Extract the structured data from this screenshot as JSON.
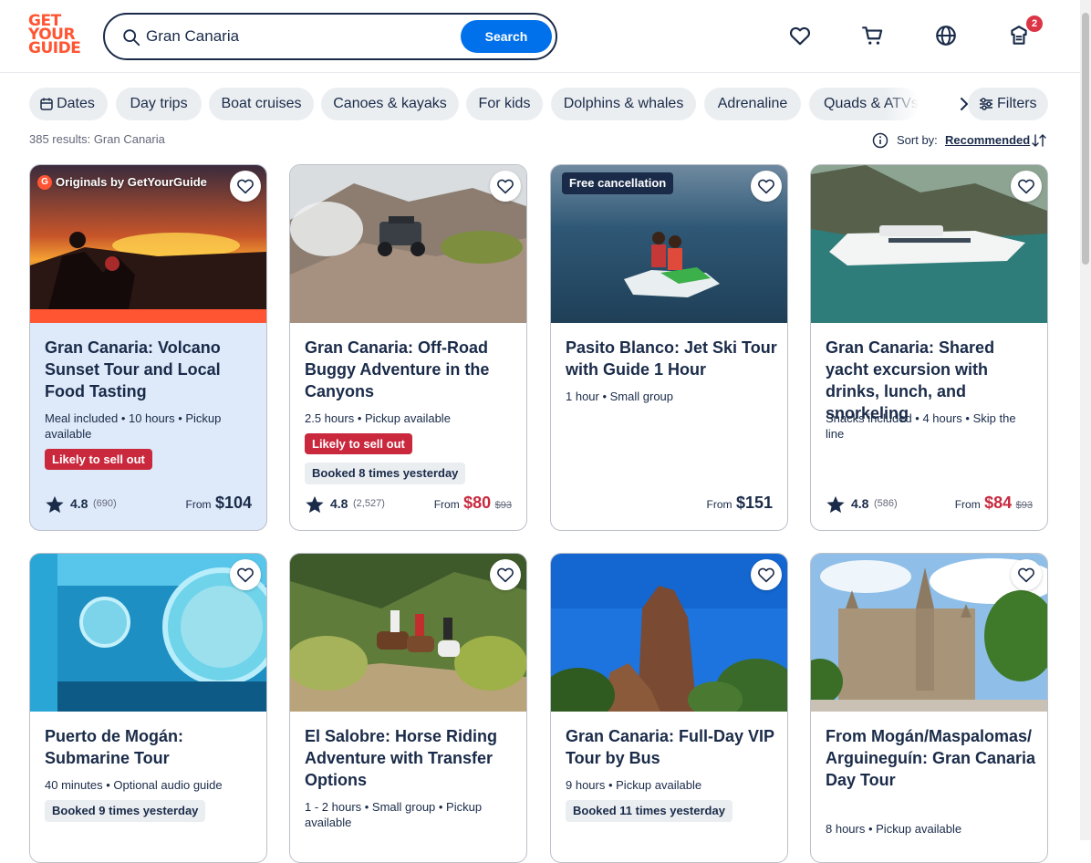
{
  "header": {
    "logo_lines": [
      "GET",
      "YOUR",
      "GUIDE"
    ],
    "search_value": "Gran Canaria",
    "search_button": "Search",
    "cart_badge": "2"
  },
  "chips": [
    "Dates",
    "Day trips",
    "Boat cruises",
    "Canoes & kayaks",
    "For kids",
    "Dolphins & whales",
    "Adrenaline",
    "Quads & ATVs"
  ],
  "filters_label": "Filters",
  "results_text": "385 results: Gran Canaria",
  "sort": {
    "label": "Sort by:",
    "value": "Recommended"
  },
  "cards": [
    {
      "badge": "Originals by GetYourGuide",
      "title": "Gran Canaria: Volcano Sunset Tour and Local Food Tasting",
      "meta": "Meal included • 10 hours • Pickup available",
      "pill_red": "Likely to sell out",
      "rating": "4.8",
      "reviews": "(690)",
      "from": "From",
      "price": "$104"
    },
    {
      "title": "Gran Canaria: Off-Road Buggy Adventure in the Canyons",
      "meta": "2.5 hours • Pickup available",
      "pill_red": "Likely to sell out",
      "pill_grey": "Booked 8 times yesterday",
      "rating": "4.8",
      "reviews": "(2,527)",
      "from": "From",
      "price": "$80",
      "old_price": "$93"
    },
    {
      "badge": "Free cancellation",
      "title": "Pasito Blanco: Jet Ski Tour with Guide 1 Hour",
      "meta": "1 hour • Small group",
      "from": "From",
      "price": "$151"
    },
    {
      "title": "Gran Canaria: Shared yacht excursion with drinks, lunch, and snorkeling",
      "meta": "Snacks included • 4 hours • Skip the line",
      "rating": "4.8",
      "reviews": "(586)",
      "from": "From",
      "price": "$84",
      "old_price": "$93"
    },
    {
      "title": "Puerto de Mogán: Submarine Tour",
      "meta": "40 minutes • Optional audio guide",
      "pill_grey": "Booked 9 times yesterday"
    },
    {
      "title": "El Salobre: Horse Riding Adventure with Transfer Options",
      "meta": "1 - 2 hours • Small group • Pickup available"
    },
    {
      "title": "Gran Canaria: Full-Day VIP Tour by Bus",
      "meta": "9 hours • Pickup available",
      "pill_grey": "Booked 11 times yesterday"
    },
    {
      "title": "From Mogán/Maspalomas/Arguineguín: Gran Canaria Day Tour",
      "meta": "8 hours • Pickup available"
    }
  ]
}
